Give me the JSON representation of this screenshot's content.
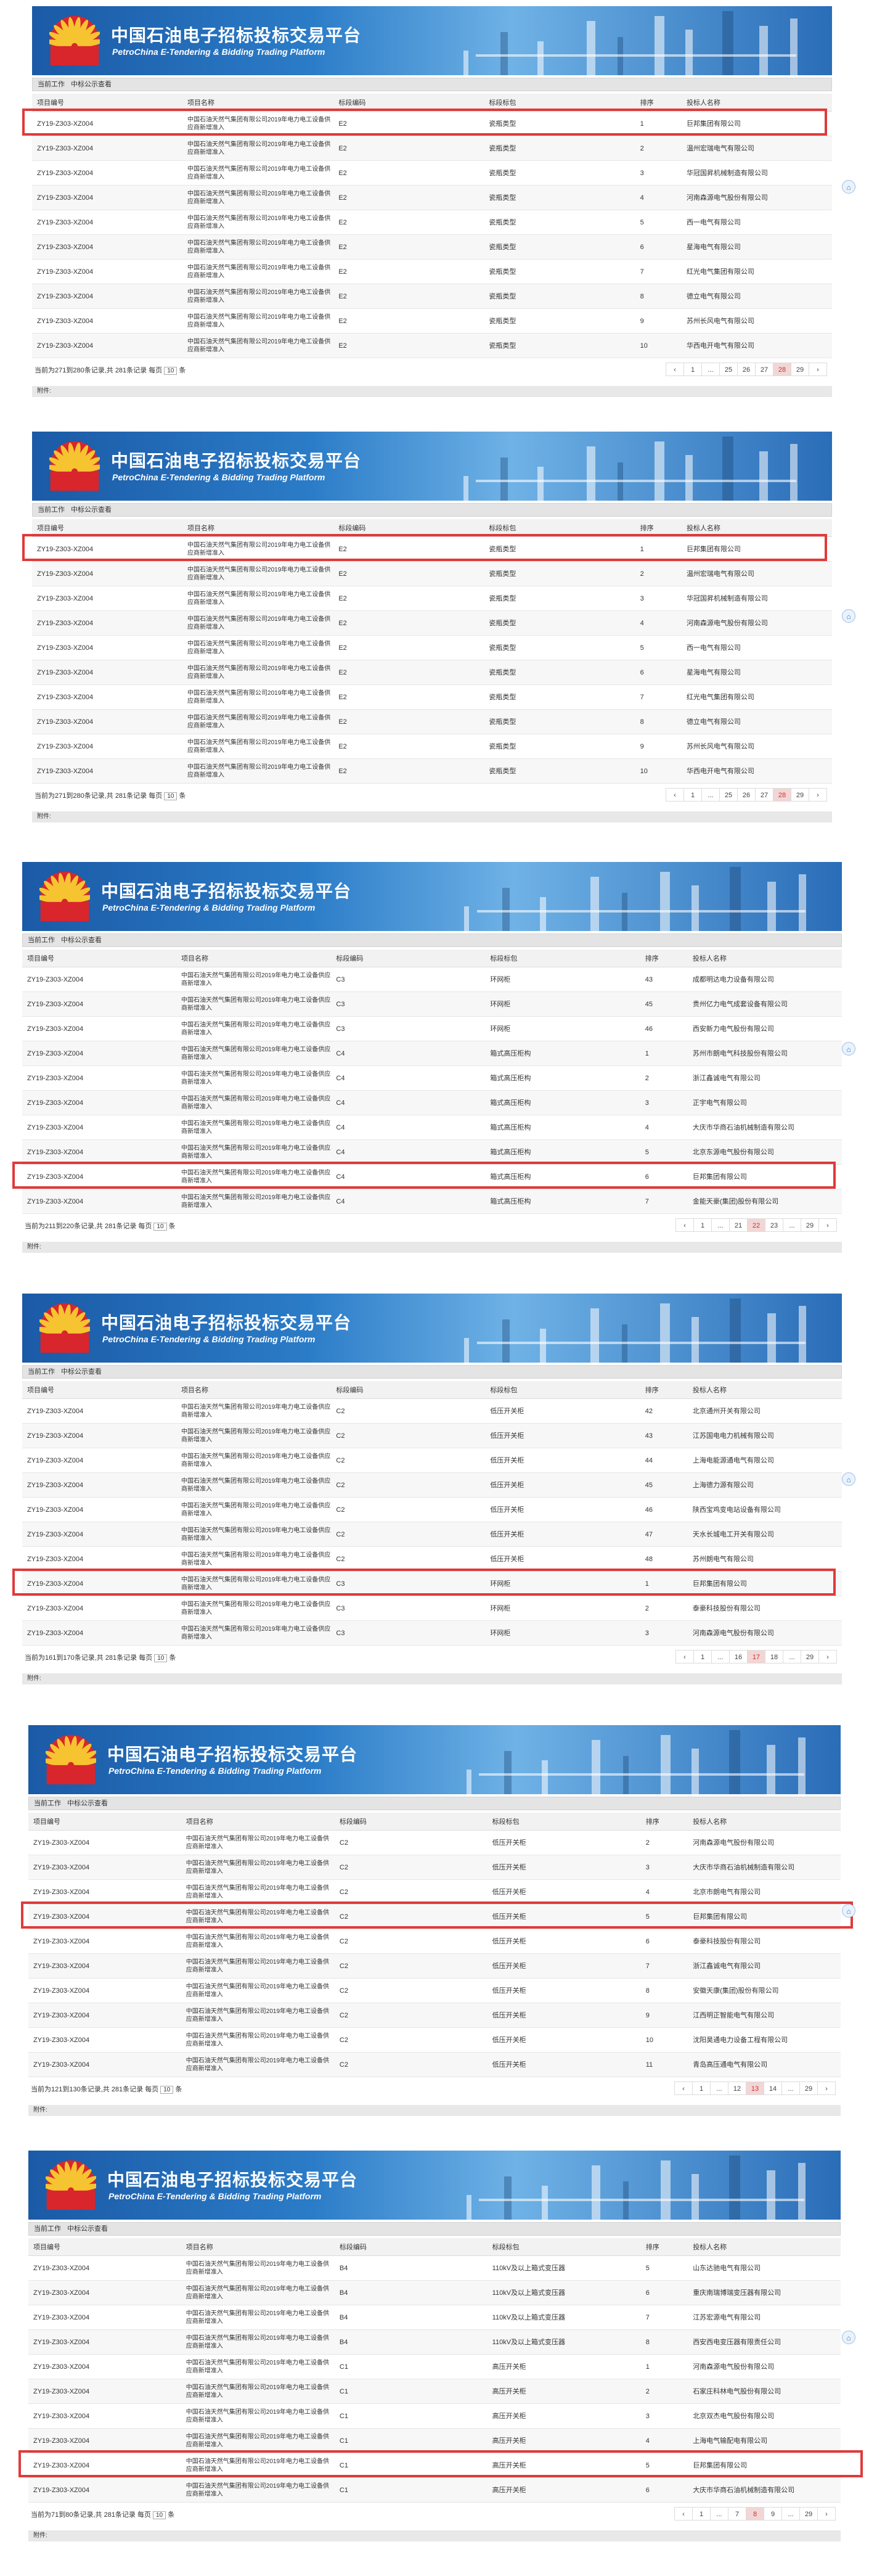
{
  "header": {
    "title_cn": "中国石油电子招标投标交易平台",
    "title_en": "PetroChina E-Tendering & Bidding Trading Platform"
  },
  "breadcrumb": [
    "当前工作",
    "中标公示查看"
  ],
  "columns": [
    "项目编号",
    "项目名称",
    "标段编码",
    "标段标包",
    "排序",
    "投标人名称"
  ],
  "project_name": "中国石油天然气集团有限公司2019年电力电工设备供应商新增准入",
  "project_code": "ZY19-Z303-XZ004",
  "attachment_label": "附件:",
  "panels": [
    {
      "rows": [
        {
          "seg": "E2",
          "pkg": "瓷瓶类型",
          "rank": "1",
          "bidder": "巨邦集团有限公司",
          "hl": true
        },
        {
          "seg": "E2",
          "pkg": "瓷瓶类型",
          "rank": "2",
          "bidder": "温州宏瑞电气有限公司"
        },
        {
          "seg": "E2",
          "pkg": "瓷瓶类型",
          "rank": "3",
          "bidder": "华冠国昇机械制造有限公司"
        },
        {
          "seg": "E2",
          "pkg": "瓷瓶类型",
          "rank": "4",
          "bidder": "河南森源电气股份有限公司"
        },
        {
          "seg": "E2",
          "pkg": "瓷瓶类型",
          "rank": "5",
          "bidder": "西一电气有限公司"
        },
        {
          "seg": "E2",
          "pkg": "瓷瓶类型",
          "rank": "6",
          "bidder": "星海电气有限公司"
        },
        {
          "seg": "E2",
          "pkg": "瓷瓶类型",
          "rank": "7",
          "bidder": "红光电气集团有限公司"
        },
        {
          "seg": "E2",
          "pkg": "瓷瓶类型",
          "rank": "8",
          "bidder": "德立电气有限公司"
        },
        {
          "seg": "E2",
          "pkg": "瓷瓶类型",
          "rank": "9",
          "bidder": "苏州长风电气有限公司"
        },
        {
          "seg": "E2",
          "pkg": "瓷瓶类型",
          "rank": "10",
          "bidder": "华西电开电气有限公司"
        }
      ],
      "info": {
        "pre": "当前为271到280条记录,共 281条记录 每页",
        "size": "10",
        "post": "条"
      },
      "pages": [
        "‹",
        "1",
        "...",
        "25",
        "26",
        "27",
        "28",
        "29",
        "›"
      ],
      "active": "28"
    },
    {
      "rows": [
        {
          "seg": "E2",
          "pkg": "瓷瓶类型",
          "rank": "1",
          "bidder": "巨邦集团有限公司",
          "hl": true
        },
        {
          "seg": "E2",
          "pkg": "瓷瓶类型",
          "rank": "2",
          "bidder": "温州宏瑞电气有限公司"
        },
        {
          "seg": "E2",
          "pkg": "瓷瓶类型",
          "rank": "3",
          "bidder": "华冠国昇机械制造有限公司"
        },
        {
          "seg": "E2",
          "pkg": "瓷瓶类型",
          "rank": "4",
          "bidder": "河南森源电气股份有限公司"
        },
        {
          "seg": "E2",
          "pkg": "瓷瓶类型",
          "rank": "5",
          "bidder": "西一电气有限公司"
        },
        {
          "seg": "E2",
          "pkg": "瓷瓶类型",
          "rank": "6",
          "bidder": "星海电气有限公司"
        },
        {
          "seg": "E2",
          "pkg": "瓷瓶类型",
          "rank": "7",
          "bidder": "红光电气集团有限公司"
        },
        {
          "seg": "E2",
          "pkg": "瓷瓶类型",
          "rank": "8",
          "bidder": "德立电气有限公司"
        },
        {
          "seg": "E2",
          "pkg": "瓷瓶类型",
          "rank": "9",
          "bidder": "苏州长风电气有限公司"
        },
        {
          "seg": "E2",
          "pkg": "瓷瓶类型",
          "rank": "10",
          "bidder": "华西电开电气有限公司"
        }
      ],
      "info": {
        "pre": "当前为271到280条记录,共 281条记录 每页",
        "size": "10",
        "post": "条"
      },
      "pages": [
        "‹",
        "1",
        "...",
        "25",
        "26",
        "27",
        "28",
        "29",
        "›"
      ],
      "active": "28"
    },
    {
      "rows": [
        {
          "seg": "C3",
          "pkg": "环网柜",
          "rank": "43",
          "bidder": "成都明达电力设备有限公司"
        },
        {
          "seg": "C3",
          "pkg": "环网柜",
          "rank": "45",
          "bidder": "贵州亿力电气成套设备有限公司"
        },
        {
          "seg": "C3",
          "pkg": "环网柜",
          "rank": "46",
          "bidder": "西安新力电气股份有限公司"
        },
        {
          "seg": "C4",
          "pkg": "箱式高压柜构",
          "rank": "1",
          "bidder": "苏州市朗电气科技股份有限公司"
        },
        {
          "seg": "C4",
          "pkg": "箱式高压柜构",
          "rank": "2",
          "bidder": "浙江鑫诚电气有限公司"
        },
        {
          "seg": "C4",
          "pkg": "箱式高压柜构",
          "rank": "3",
          "bidder": "正宇电气有限公司"
        },
        {
          "seg": "C4",
          "pkg": "箱式高压柜构",
          "rank": "4",
          "bidder": "大庆市华商石油机械制造有限公司"
        },
        {
          "seg": "C4",
          "pkg": "箱式高压柜构",
          "rank": "5",
          "bidder": "北京东源电气股份有限公司"
        },
        {
          "seg": "C4",
          "pkg": "箱式高压柜构",
          "rank": "6",
          "bidder": "巨邦集团有限公司",
          "hl": true
        },
        {
          "seg": "C4",
          "pkg": "箱式高压柜构",
          "rank": "7",
          "bidder": "金能天豪(集团)股份有限公司"
        }
      ],
      "info": {
        "pre": "当前为211到220条记录,共 281条记录 每页",
        "size": "10",
        "post": "条"
      },
      "pages": [
        "‹",
        "1",
        "...",
        "21",
        "22",
        "23",
        "...",
        "29",
        "›"
      ],
      "active": "22"
    },
    {
      "rows": [
        {
          "seg": "C2",
          "pkg": "低压开关柜",
          "rank": "42",
          "bidder": "北京通州开关有限公司"
        },
        {
          "seg": "C2",
          "pkg": "低压开关柜",
          "rank": "43",
          "bidder": "江苏国电电力机械有限公司"
        },
        {
          "seg": "C2",
          "pkg": "低压开关柜",
          "rank": "44",
          "bidder": "上海电能源通电气有限公司"
        },
        {
          "seg": "C2",
          "pkg": "低压开关柜",
          "rank": "45",
          "bidder": "上海德力源有限公司"
        },
        {
          "seg": "C2",
          "pkg": "低压开关柜",
          "rank": "46",
          "bidder": "陕西宝鸡变电站设备有限公司"
        },
        {
          "seg": "C2",
          "pkg": "低压开关柜",
          "rank": "47",
          "bidder": "天水长城电工开关有限公司"
        },
        {
          "seg": "C2",
          "pkg": "低压开关柜",
          "rank": "48",
          "bidder": "苏州朗电气有限公司"
        },
        {
          "seg": "C3",
          "pkg": "环网柜",
          "rank": "1",
          "bidder": "巨邦集团有限公司",
          "hl": true
        },
        {
          "seg": "C3",
          "pkg": "环网柜",
          "rank": "2",
          "bidder": "泰豪科技股份有限公司"
        },
        {
          "seg": "C3",
          "pkg": "环网柜",
          "rank": "3",
          "bidder": "河南森源电气股份有限公司"
        }
      ],
      "info": {
        "pre": "当前为161到170条记录,共 281条记录 每页",
        "size": "10",
        "post": "条"
      },
      "pages": [
        "‹",
        "1",
        "...",
        "16",
        "17",
        "18",
        "...",
        "29",
        "›"
      ],
      "active": "17"
    },
    {
      "rows": [
        {
          "seg": "C2",
          "pkg": "低压开关柜",
          "rank": "2",
          "bidder": "河南森源电气股份有限公司"
        },
        {
          "seg": "C2",
          "pkg": "低压开关柜",
          "rank": "3",
          "bidder": "大庆市华商石油机械制造有限公司"
        },
        {
          "seg": "C2",
          "pkg": "低压开关柜",
          "rank": "4",
          "bidder": "北京市朗电气有限公司"
        },
        {
          "seg": "C2",
          "pkg": "低压开关柜",
          "rank": "5",
          "bidder": "巨邦集团有限公司",
          "hl": true
        },
        {
          "seg": "C2",
          "pkg": "低压开关柜",
          "rank": "6",
          "bidder": "泰豪科技股份有限公司"
        },
        {
          "seg": "C2",
          "pkg": "低压开关柜",
          "rank": "7",
          "bidder": "浙江鑫诚电气有限公司"
        },
        {
          "seg": "C2",
          "pkg": "低压开关柜",
          "rank": "8",
          "bidder": "安徽天康(集团)股份有限公司"
        },
        {
          "seg": "C2",
          "pkg": "低压开关柜",
          "rank": "9",
          "bidder": "江西明正智能电气有限公司"
        },
        {
          "seg": "C2",
          "pkg": "低压开关柜",
          "rank": "10",
          "bidder": "沈阳昊通电力设备工程有限公司"
        },
        {
          "seg": "C2",
          "pkg": "低压开关柜",
          "rank": "11",
          "bidder": "青岛高压通电气有限公司"
        }
      ],
      "info": {
        "pre": "当前为121到130条记录,共 281条记录 每页",
        "size": "10",
        "post": "条"
      },
      "pages": [
        "‹",
        "1",
        "...",
        "12",
        "13",
        "14",
        "...",
        "29",
        "›"
      ],
      "active": "13"
    },
    {
      "rows": [
        {
          "seg": "B4",
          "pkg": "110kV及以上箱式变压器",
          "rank": "5",
          "bidder": "山东达驰电气有限公司"
        },
        {
          "seg": "B4",
          "pkg": "110kV及以上箱式变压器",
          "rank": "6",
          "bidder": "重庆南瑞博瑞变压器有限公司"
        },
        {
          "seg": "B4",
          "pkg": "110kV及以上箱式变压器",
          "rank": "7",
          "bidder": "江苏宏源电气有限公司"
        },
        {
          "seg": "B4",
          "pkg": "110kV及以上箱式变压器",
          "rank": "8",
          "bidder": "西安西电变压器有限责任公司"
        },
        {
          "seg": "C1",
          "pkg": "高压开关柜",
          "rank": "1",
          "bidder": "河南森源电气股份有限公司"
        },
        {
          "seg": "C1",
          "pkg": "高压开关柜",
          "rank": "2",
          "bidder": "石家庄科林电气股份有限公司"
        },
        {
          "seg": "C1",
          "pkg": "高压开关柜",
          "rank": "3",
          "bidder": "北京双杰电气股份有限公司"
        },
        {
          "seg": "C1",
          "pkg": "高压开关柜",
          "rank": "4",
          "bidder": "上海电气输配电有限公司"
        },
        {
          "seg": "C1",
          "pkg": "高压开关柜",
          "rank": "5",
          "bidder": "巨邦集团有限公司",
          "hl": true
        },
        {
          "seg": "C1",
          "pkg": "高压开关柜",
          "rank": "6",
          "bidder": "大庆市华商石油机械制造有限公司"
        }
      ],
      "info": {
        "pre": "当前为71到80条记录,共 281条记录 每页",
        "size": "10",
        "post": "条"
      },
      "pages": [
        "‹",
        "1",
        "...",
        "7",
        "8",
        "9",
        "...",
        "29",
        "›"
      ],
      "active": "8"
    }
  ]
}
